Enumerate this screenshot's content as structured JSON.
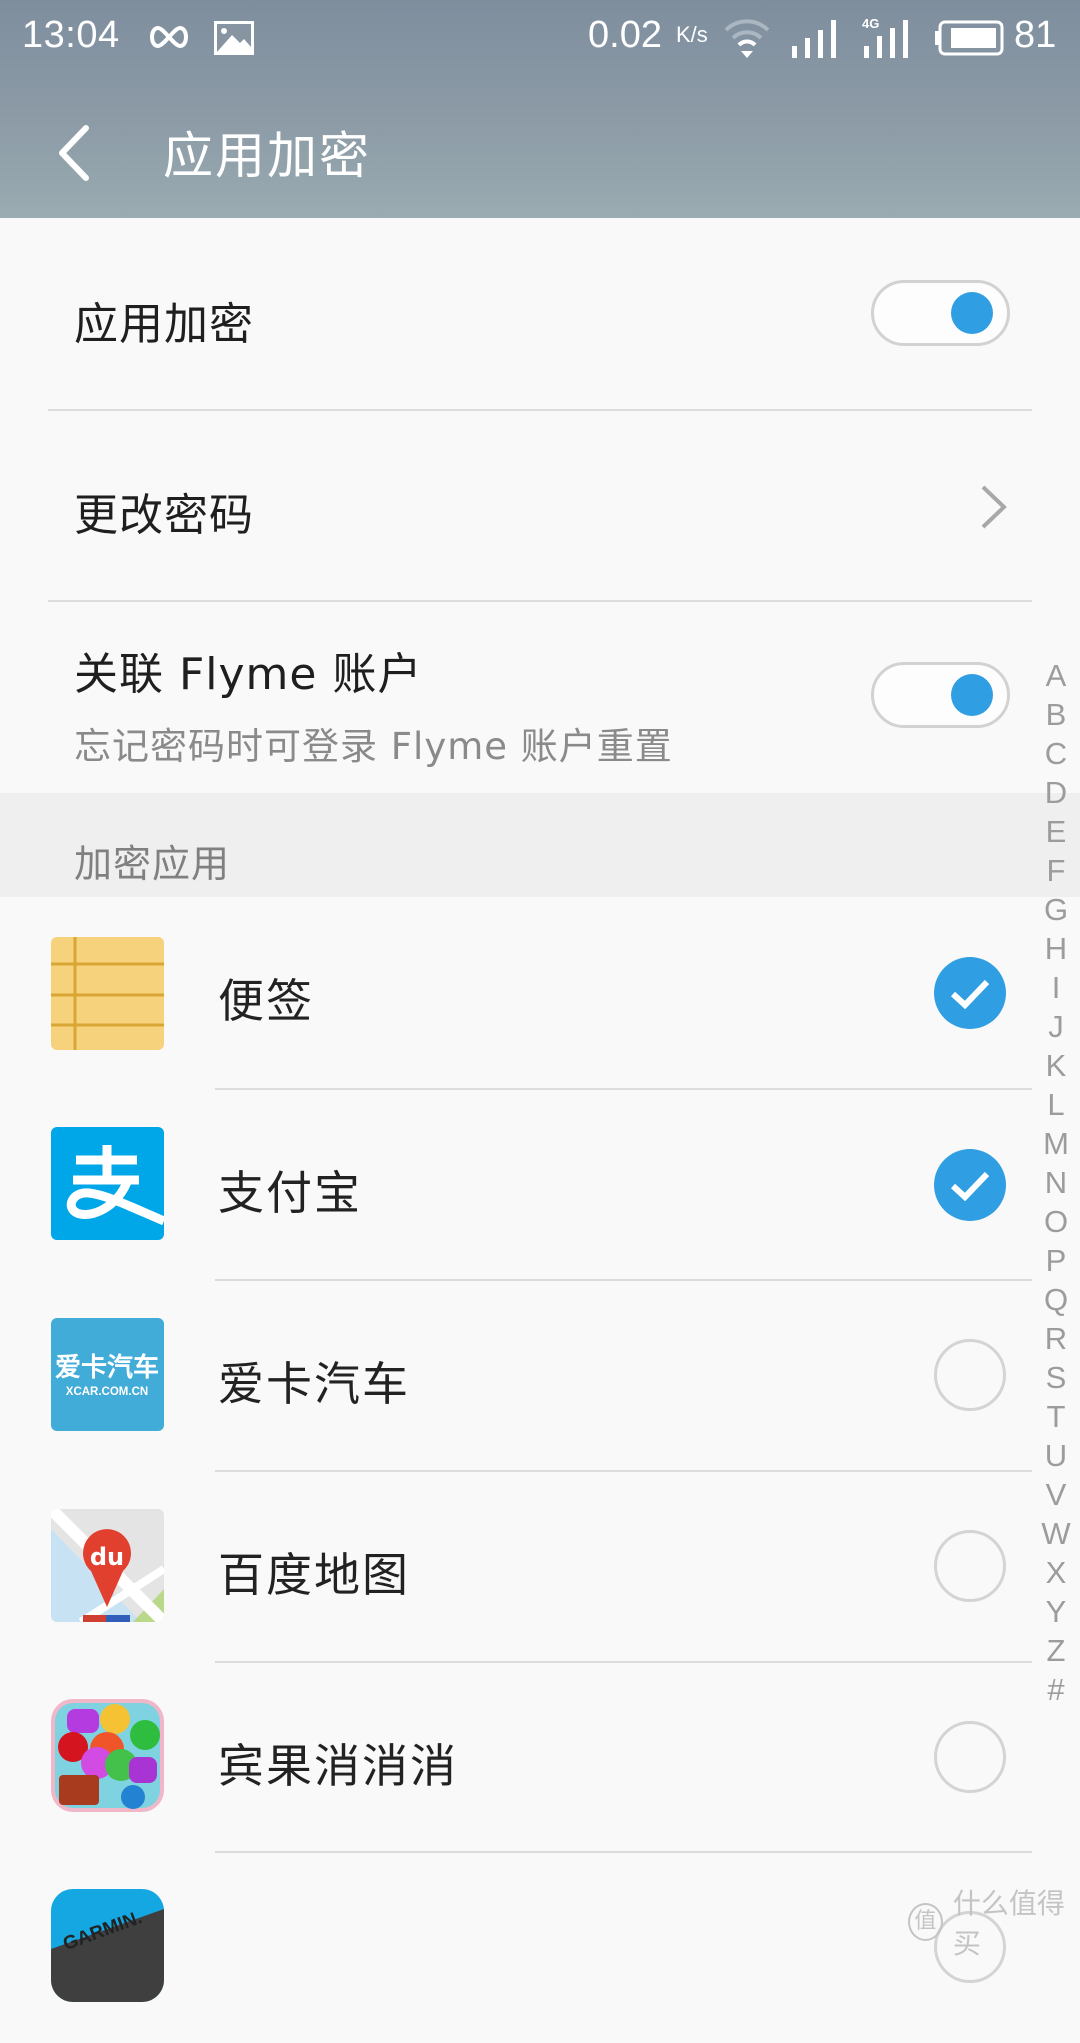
{
  "status_bar": {
    "time": "13:04",
    "speed": "0.02",
    "speed_unit": "K/s",
    "network_label": "4G",
    "battery_percent": "81",
    "icons": [
      "infinity-icon",
      "image-icon",
      "wifi-icon",
      "signal-icon",
      "signal-4g-icon",
      "battery-icon"
    ]
  },
  "app_bar": {
    "back_icon": "chevron-left-icon",
    "title": "应用加密"
  },
  "settings": {
    "app_lock": {
      "label": "应用加密",
      "enabled": true
    },
    "change_password": {
      "label": "更改密码",
      "icon": "chevron-right-icon"
    },
    "link_flyme": {
      "label": "关联 Flyme 账户",
      "sublabel": "忘记密码时可登录 Flyme 账户重置",
      "enabled": true
    }
  },
  "section_header": "加密应用",
  "apps": [
    {
      "name": "便签",
      "icon": "notes-app-icon",
      "checked": true
    },
    {
      "name": "支付宝",
      "icon": "alipay-app-icon",
      "checked": true
    },
    {
      "name": "爱卡汽车",
      "icon": "xcar-app-icon",
      "icon_text": "爱卡汽车",
      "icon_subtext": "XCAR.COM.CN",
      "checked": false
    },
    {
      "name": "百度地图",
      "icon": "baidu-map-app-icon",
      "icon_text": "du",
      "checked": false
    },
    {
      "name": "宾果消消消",
      "icon": "bingo-game-app-icon",
      "checked": false
    },
    {
      "name": "",
      "icon": "garmin-app-icon",
      "icon_text": "GARMIN.",
      "checked": false
    }
  ],
  "alphabet_index": [
    "A",
    "B",
    "C",
    "D",
    "E",
    "F",
    "G",
    "H",
    "I",
    "J",
    "K",
    "L",
    "M",
    "N",
    "O",
    "P",
    "Q",
    "R",
    "S",
    "T",
    "U",
    "V",
    "W",
    "X",
    "Y",
    "Z",
    "#"
  ],
  "watermark": {
    "badge": "值",
    "text": "什么值得买"
  },
  "colors": {
    "accent": "#2f9ee3",
    "header_top": "#7f8e9e",
    "header_bottom": "#9aabb1",
    "background": "#f9f9f9",
    "section_bg": "#efefef"
  }
}
